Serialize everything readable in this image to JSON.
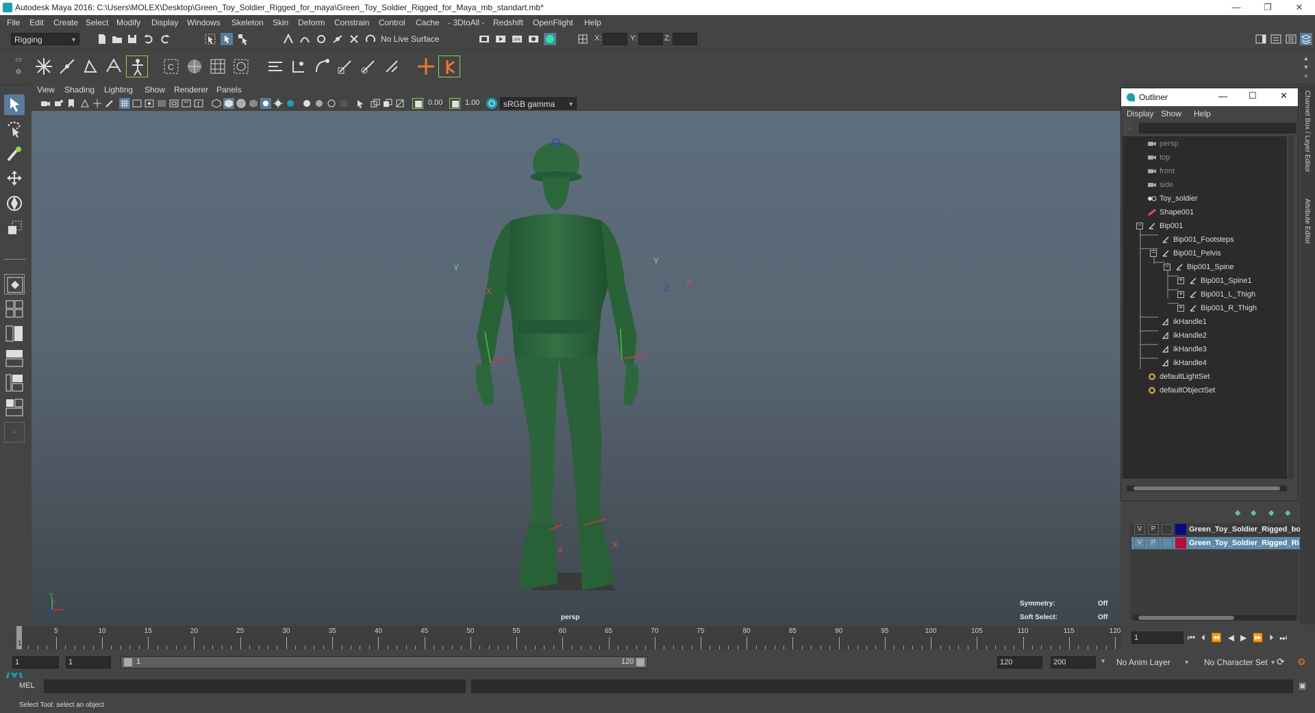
{
  "window": {
    "title": "Autodesk Maya 2016: C:\\Users\\MOLEX\\Desktop\\Green_Toy_Soldier_Rigged_for_maya\\Green_Toy_Soldier_Rigged_for_Maya_mb_standart.mb*",
    "minimize": "—",
    "maximize": "❐",
    "close": "✕"
  },
  "menubar": [
    "File",
    "Edit",
    "Create",
    "Select",
    "Modify",
    "Display",
    "Windows",
    "Skeleton",
    "Skin",
    "Deform",
    "Constrain",
    "Control",
    "Cache",
    "- 3DtoAll -",
    "Redshift",
    "OpenFlight",
    "Help"
  ],
  "statusline": {
    "menuset": "Rigging",
    "live_surface": "No Live Surface",
    "x_label": "X:",
    "y_label": "Y:",
    "z_label": "Z:"
  },
  "viewport": {
    "menus": [
      "View",
      "Shading",
      "Lighting",
      "Show",
      "Renderer",
      "Panels"
    ],
    "exposure": "0.00",
    "gamma": "1.00",
    "color_space": "sRGB gamma",
    "camera_label": "persp",
    "symmetry_label": "Symmetry:",
    "symmetry_value": "Off",
    "soft_select_label": "Soft Select:",
    "soft_select_value": "Off",
    "axis_labels": {
      "x": "X",
      "y": "Y",
      "z": "Z"
    }
  },
  "outliner": {
    "title": "Outliner",
    "menus": [
      "Display",
      "Show",
      "Help"
    ],
    "items": [
      {
        "label": "persp",
        "dim": true,
        "indent": 0,
        "icon": "camera-icon"
      },
      {
        "label": "top",
        "dim": true,
        "indent": 0,
        "icon": "camera-icon"
      },
      {
        "label": "front",
        "dim": true,
        "indent": 0,
        "icon": "camera-icon"
      },
      {
        "label": "side",
        "dim": true,
        "indent": 0,
        "icon": "camera-icon"
      },
      {
        "label": "Toy_soldier",
        "dim": false,
        "indent": 0,
        "icon": "group-icon"
      },
      {
        "label": "Shape001",
        "dim": false,
        "indent": 0,
        "icon": "shape-icon"
      },
      {
        "label": "Bip001",
        "dim": false,
        "indent": 0,
        "icon": "joint-icon",
        "expand": "−"
      },
      {
        "label": "Bip001_Footsteps",
        "dim": false,
        "indent": 1,
        "icon": "joint-icon"
      },
      {
        "label": "Bip001_Pelvis",
        "dim": false,
        "indent": 1,
        "icon": "joint-icon",
        "expand": "−"
      },
      {
        "label": "Bip001_Spine",
        "dim": false,
        "indent": 2,
        "icon": "joint-icon",
        "expand": "−"
      },
      {
        "label": "Bip001_Spine1",
        "dim": false,
        "indent": 3,
        "icon": "joint-icon",
        "expand": "+"
      },
      {
        "label": "Bip001_L_Thigh",
        "dim": false,
        "indent": 3,
        "icon": "joint-icon",
        "expand": "+"
      },
      {
        "label": "Bip001_R_Thigh",
        "dim": false,
        "indent": 3,
        "icon": "joint-icon",
        "expand": "+"
      },
      {
        "label": "ikHandle1",
        "dim": false,
        "indent": 1,
        "icon": "ik-handle-icon"
      },
      {
        "label": "ikHandle2",
        "dim": false,
        "indent": 1,
        "icon": "ik-handle-icon"
      },
      {
        "label": "ikHandle3",
        "dim": false,
        "indent": 1,
        "icon": "ik-handle-icon"
      },
      {
        "label": "ikHandle4",
        "dim": false,
        "indent": 1,
        "icon": "ik-handle-icon"
      },
      {
        "label": "defaultLightSet",
        "dim": false,
        "indent": 0,
        "icon": "set-icon"
      },
      {
        "label": "defaultObjectSet",
        "dim": false,
        "indent": 0,
        "icon": "set-icon"
      }
    ]
  },
  "layers": [
    {
      "v": "V",
      "p": "P",
      "color": "#0a0a80",
      "name": "Green_Toy_Soldier_Rigged_bo",
      "selected": false
    },
    {
      "v": "V",
      "p": "P",
      "color": "#b0103a",
      "name": "Green_Toy_Soldier_Rigged_Ri",
      "selected": true
    }
  ],
  "side_tabs": [
    "Channel Box / Layer Editor",
    "Attribute Editor"
  ],
  "timeline": {
    "ticks": [
      "5",
      "10",
      "15",
      "20",
      "25",
      "30",
      "35",
      "40",
      "45",
      "50",
      "55",
      "60",
      "65",
      "70",
      "75",
      "80",
      "85",
      "90",
      "95",
      "100",
      "105",
      "110",
      "115",
      "120"
    ],
    "start_marker": "1",
    "current_frame": "1"
  },
  "range": {
    "start": "1",
    "playback_start": "1",
    "slider_left": "1",
    "slider_right": "120",
    "playback_end": "120",
    "end": "200",
    "anim_layer": "No Anim Layer",
    "character_set": "No Character Set"
  },
  "command_line": {
    "label": "MEL"
  },
  "help_line": "Select Tool: select an object",
  "colors": {
    "soldier_green": "#2f6a3e",
    "viewport_top": "#5d6e7d",
    "accent": "#1e9fb0"
  }
}
